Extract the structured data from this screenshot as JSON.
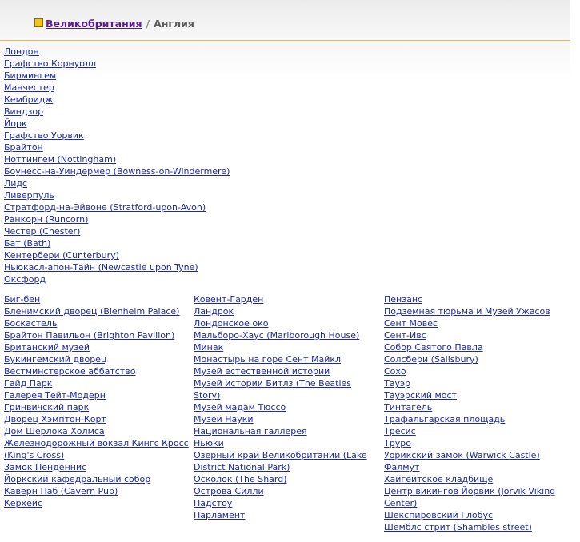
{
  "breadcrumb": {
    "parent": "Великобритания",
    "separator": "/",
    "current": "Англия"
  },
  "cities": [
    "Лондон",
    "Графство Корнуолл",
    "Бирмингем",
    "Манчестер",
    "Кембридж",
    "Виндзор",
    "Йорк",
    "Графство Уорвик",
    "Брайтон",
    "Ноттингем (Nottingham)",
    "Боунесс-на-Уиндермер (Bowness-on-Windermere) ",
    "Лидс",
    "Ливерпуль",
    "Стратфорд-на-Эйвоне (Stratford-upon-Avon)",
    "Ранкорн (Runcorn)",
    "Честер (Chester)",
    "Бат (Bath)",
    "Кентербери (Cunterbury)",
    "Ньюкасл-апон-Тайн (Newcastle upon Tyne)",
    "Оксфорд"
  ],
  "attractions": {
    "col1": [
      "Биг-бен",
      "Бленимский дворец (Blenheim Palace)",
      "Боскастель",
      "Брайтон Павильон (Brighton Pavilion)",
      "Британский музей",
      "Букингемский дворец",
      "Вестминстерское аббатство",
      "Гайд Парк",
      "Галерея Тейт-Модерн",
      "Гринвичский парк",
      "Дворец Хэмптон-Корт",
      "Дом Шерлока Холмса",
      "Железнодорожный вокзал Кингс Кросс (King's Cross)",
      "Замок Пенденнис",
      "Йоркский кафедральный собор",
      "Каверн Паб (Cavern Pub)",
      "Керхейс"
    ],
    "col2": [
      "Ковент-Гарден",
      "Ландрок",
      "Лондонское око",
      "Мальборо-Хаус (Marlborough House)",
      "Минак",
      "Монастырь на горе Сент Майкл",
      "Музей естественной истории",
      "Музей истории Битлз (The Beatles Story)",
      "Музей мадам Тюссо",
      "Музей Науки",
      "Национальная галлерея",
      "Ньюки",
      "Озерный край Великобритании (Lake District National Park)",
      "Осколок (The Shard)",
      "Острова Силли",
      "Падстоу",
      "Парламент"
    ],
    "col3": [
      "Пензанс",
      "Подземная тюрьма и Музей Ужасов",
      "Сент Мовес",
      "Сент-Ивс",
      "Собор Святого Павла",
      "Солсбери (Salisbury)",
      "Сохо",
      "Тауэр",
      "Тауэрский мост",
      "Тинтагель",
      "Трафальгарская площадь",
      "Тресис",
      "Труро",
      "Уорикский замок (Warwick Castle)",
      "Фалмут",
      "Хайгейтское кладбище",
      "Центр викингов Йорвик (Jorvik Viking Center)",
      "Шекспировский Глобус",
      "Шемблс стрит (Shambles street)"
    ]
  }
}
